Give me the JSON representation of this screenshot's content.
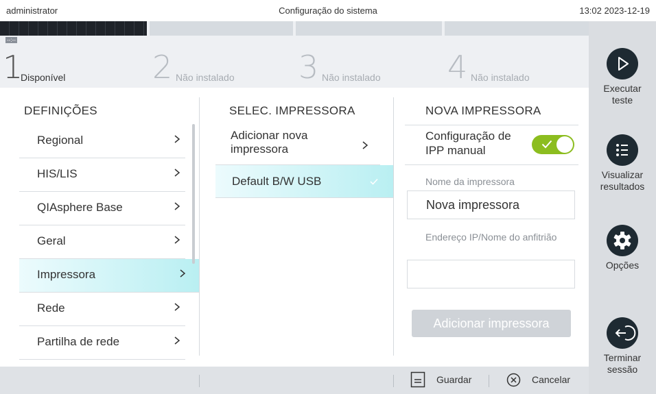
{
  "topbar": {
    "user": "administrator",
    "title": "Configuração do sistema",
    "clock": "13:02 2023-12-19"
  },
  "modules": [
    {
      "number": "1",
      "state": "Disponível",
      "time": "--:--"
    },
    {
      "number": "2",
      "state": "Não instalado"
    },
    {
      "number": "3",
      "state": "Não instalado"
    },
    {
      "number": "4",
      "state": "Não instalado"
    }
  ],
  "sidebar": {
    "run": "Executar teste",
    "results": "Visualizar resultados",
    "options": "Opções",
    "logout": "Terminar sessão"
  },
  "settings": {
    "header": "DEFINIÇÕES",
    "items": [
      "Regional",
      "HIS/LIS",
      "QIAsphere Base",
      "Geral",
      "Impressora",
      "Rede",
      "Partilha de rede"
    ],
    "selected_index": 4
  },
  "printer_select": {
    "header": "SELEC. IMPRESSORA",
    "add_new": "Adicionar nova impressora",
    "printers": [
      "Default B/W USB"
    ]
  },
  "new_printer": {
    "header": "NOVA IMPRESSORA",
    "manual_ipp_label": "Configuração de IPP manual",
    "manual_ipp_on": true,
    "name_label": "Nome da impressora",
    "name_value": "Nova impressora",
    "address_label": "Endereço IP/Nome do anfitrião",
    "address_value": "",
    "add_button": "Adicionar impressora"
  },
  "bottom": {
    "save": "Guardar",
    "cancel": "Cancelar"
  },
  "colors": {
    "accent_green": "#8cbd1f",
    "selected_cyan": "#b9eff2",
    "icon_dark": "#1e2a32"
  }
}
